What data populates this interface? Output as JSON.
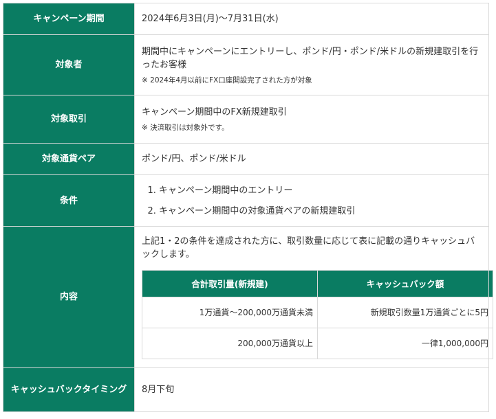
{
  "rows": {
    "period": {
      "label": "キャンペーン期間",
      "value": "2024年6月3日(月)～7月31日(水)"
    },
    "target": {
      "label": "対象者",
      "value": "期間中にキャンペーンにエントリーし、ポンド/円・ポンド/米ドルの新規建取引を行ったお客様",
      "note": "※ 2024年4月以前にFX口座開設完了された方が対象"
    },
    "trade": {
      "label": "対象取引",
      "value": "キャンペーン期間中のFX新規建取引",
      "note": "※ 決済取引は対象外です。"
    },
    "pairs": {
      "label": "対象通貨ペア",
      "value": "ポンド/円、ポンド/米ドル"
    },
    "conditions": {
      "label": "条件",
      "items": [
        "キャンペーン期間中のエントリー",
        "キャンペーン期間中の対象通貨ペアの新規建取引"
      ]
    },
    "content": {
      "label": "内容",
      "intro": "上記1・2の条件を達成された方に、取引数量に応じて表に記載の通りキャッシュバックします。",
      "table": {
        "headers": [
          "合計取引量(新規建)",
          "キャッシュバック額"
        ],
        "rows": [
          [
            "1万通貨～200,000万通貨未満",
            "新規取引数量1万通貨ごとに5円"
          ],
          [
            "200,000万通貨以上",
            "一律1,000,000円"
          ]
        ]
      }
    },
    "timing": {
      "label": "キャッシュバックタイミング",
      "value": "8月下旬"
    }
  },
  "colors": {
    "header_bg": "#0a7c62",
    "border": "#d9d9d9",
    "text": "#333333"
  }
}
